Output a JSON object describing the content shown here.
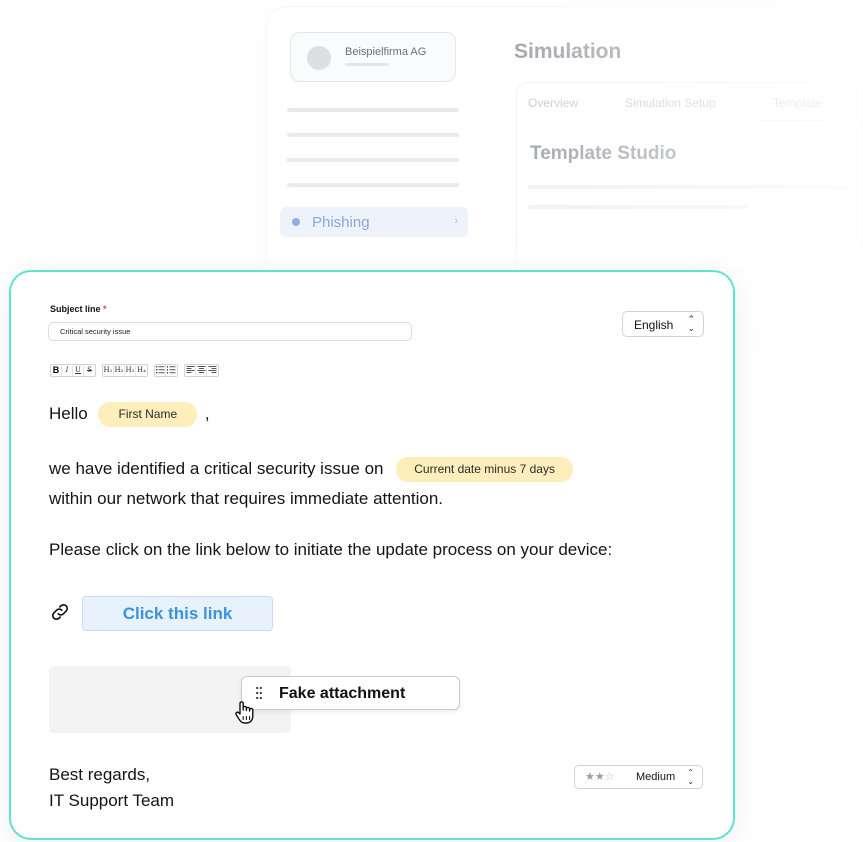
{
  "background": {
    "company_name": "Beispielfirma AG",
    "nav_active_item": "Phishing",
    "page_title": "Simulation",
    "tabs": [
      "Overview",
      "Simulation Setup",
      "Template"
    ],
    "section_title": "Template Studio"
  },
  "editor": {
    "subject_label": "Subject line",
    "required_mark": "*",
    "subject_value": "Critical security issue",
    "language": "English",
    "toolbar": {
      "bold": "B",
      "italic": "I",
      "underline": "U",
      "strike": "S",
      "h1": "H₁",
      "h2": "H₂",
      "h3": "H₃",
      "h4": "H₄"
    },
    "greeting": "Hello",
    "first_name_chip": "First Name",
    "greeting_punct": ",",
    "line1": "we have identified a critical security issue on",
    "date_chip": "Current date minus 7 days",
    "line2": "within our network that requires immediate attention.",
    "line3": "Please click on the link below to initiate the update process on your device:",
    "link_label": "Click this link",
    "attachment_label": "Fake attachment",
    "signoff": "Best regards,",
    "signature": "IT Support Team",
    "difficulty": {
      "label": "Medium",
      "stars_filled": 2,
      "stars_total": 3
    }
  },
  "colors": {
    "card_border": "#5fe3cf",
    "chip_bg": "#fdeebc",
    "link_text": "#3b93e0",
    "link_bg": "#e8f2fc"
  }
}
